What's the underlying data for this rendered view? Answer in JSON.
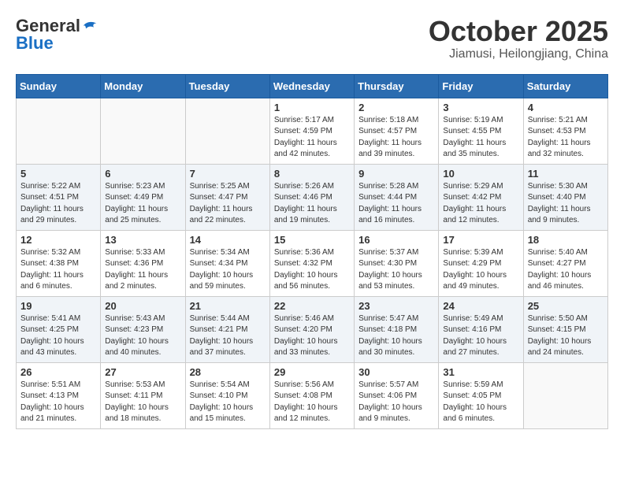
{
  "logo": {
    "general": "General",
    "blue": "Blue"
  },
  "header": {
    "month": "October 2025",
    "location": "Jiamusi, Heilongjiang, China"
  },
  "weekdays": [
    "Sunday",
    "Monday",
    "Tuesday",
    "Wednesday",
    "Thursday",
    "Friday",
    "Saturday"
  ],
  "weeks": [
    [
      {
        "day": "",
        "info": ""
      },
      {
        "day": "",
        "info": ""
      },
      {
        "day": "",
        "info": ""
      },
      {
        "day": "1",
        "info": "Sunrise: 5:17 AM\nSunset: 4:59 PM\nDaylight: 11 hours and 42 minutes."
      },
      {
        "day": "2",
        "info": "Sunrise: 5:18 AM\nSunset: 4:57 PM\nDaylight: 11 hours and 39 minutes."
      },
      {
        "day": "3",
        "info": "Sunrise: 5:19 AM\nSunset: 4:55 PM\nDaylight: 11 hours and 35 minutes."
      },
      {
        "day": "4",
        "info": "Sunrise: 5:21 AM\nSunset: 4:53 PM\nDaylight: 11 hours and 32 minutes."
      }
    ],
    [
      {
        "day": "5",
        "info": "Sunrise: 5:22 AM\nSunset: 4:51 PM\nDaylight: 11 hours and 29 minutes."
      },
      {
        "day": "6",
        "info": "Sunrise: 5:23 AM\nSunset: 4:49 PM\nDaylight: 11 hours and 25 minutes."
      },
      {
        "day": "7",
        "info": "Sunrise: 5:25 AM\nSunset: 4:47 PM\nDaylight: 11 hours and 22 minutes."
      },
      {
        "day": "8",
        "info": "Sunrise: 5:26 AM\nSunset: 4:46 PM\nDaylight: 11 hours and 19 minutes."
      },
      {
        "day": "9",
        "info": "Sunrise: 5:28 AM\nSunset: 4:44 PM\nDaylight: 11 hours and 16 minutes."
      },
      {
        "day": "10",
        "info": "Sunrise: 5:29 AM\nSunset: 4:42 PM\nDaylight: 11 hours and 12 minutes."
      },
      {
        "day": "11",
        "info": "Sunrise: 5:30 AM\nSunset: 4:40 PM\nDaylight: 11 hours and 9 minutes."
      }
    ],
    [
      {
        "day": "12",
        "info": "Sunrise: 5:32 AM\nSunset: 4:38 PM\nDaylight: 11 hours and 6 minutes."
      },
      {
        "day": "13",
        "info": "Sunrise: 5:33 AM\nSunset: 4:36 PM\nDaylight: 11 hours and 2 minutes."
      },
      {
        "day": "14",
        "info": "Sunrise: 5:34 AM\nSunset: 4:34 PM\nDaylight: 10 hours and 59 minutes."
      },
      {
        "day": "15",
        "info": "Sunrise: 5:36 AM\nSunset: 4:32 PM\nDaylight: 10 hours and 56 minutes."
      },
      {
        "day": "16",
        "info": "Sunrise: 5:37 AM\nSunset: 4:30 PM\nDaylight: 10 hours and 53 minutes."
      },
      {
        "day": "17",
        "info": "Sunrise: 5:39 AM\nSunset: 4:29 PM\nDaylight: 10 hours and 49 minutes."
      },
      {
        "day": "18",
        "info": "Sunrise: 5:40 AM\nSunset: 4:27 PM\nDaylight: 10 hours and 46 minutes."
      }
    ],
    [
      {
        "day": "19",
        "info": "Sunrise: 5:41 AM\nSunset: 4:25 PM\nDaylight: 10 hours and 43 minutes."
      },
      {
        "day": "20",
        "info": "Sunrise: 5:43 AM\nSunset: 4:23 PM\nDaylight: 10 hours and 40 minutes."
      },
      {
        "day": "21",
        "info": "Sunrise: 5:44 AM\nSunset: 4:21 PM\nDaylight: 10 hours and 37 minutes."
      },
      {
        "day": "22",
        "info": "Sunrise: 5:46 AM\nSunset: 4:20 PM\nDaylight: 10 hours and 33 minutes."
      },
      {
        "day": "23",
        "info": "Sunrise: 5:47 AM\nSunset: 4:18 PM\nDaylight: 10 hours and 30 minutes."
      },
      {
        "day": "24",
        "info": "Sunrise: 5:49 AM\nSunset: 4:16 PM\nDaylight: 10 hours and 27 minutes."
      },
      {
        "day": "25",
        "info": "Sunrise: 5:50 AM\nSunset: 4:15 PM\nDaylight: 10 hours and 24 minutes."
      }
    ],
    [
      {
        "day": "26",
        "info": "Sunrise: 5:51 AM\nSunset: 4:13 PM\nDaylight: 10 hours and 21 minutes."
      },
      {
        "day": "27",
        "info": "Sunrise: 5:53 AM\nSunset: 4:11 PM\nDaylight: 10 hours and 18 minutes."
      },
      {
        "day": "28",
        "info": "Sunrise: 5:54 AM\nSunset: 4:10 PM\nDaylight: 10 hours and 15 minutes."
      },
      {
        "day": "29",
        "info": "Sunrise: 5:56 AM\nSunset: 4:08 PM\nDaylight: 10 hours and 12 minutes."
      },
      {
        "day": "30",
        "info": "Sunrise: 5:57 AM\nSunset: 4:06 PM\nDaylight: 10 hours and 9 minutes."
      },
      {
        "day": "31",
        "info": "Sunrise: 5:59 AM\nSunset: 4:05 PM\nDaylight: 10 hours and 6 minutes."
      },
      {
        "day": "",
        "info": ""
      }
    ]
  ]
}
